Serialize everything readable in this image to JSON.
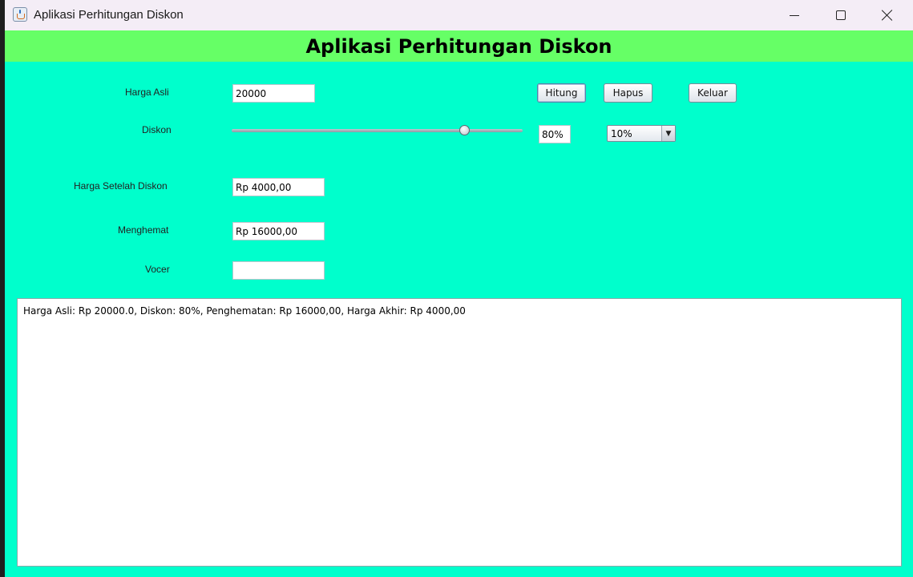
{
  "window": {
    "title": "Aplikasi Perhitungan Diskon",
    "controls": {
      "minimize": "minimize-icon",
      "maximize": "maximize-icon",
      "close": "close-icon"
    }
  },
  "banner": {
    "title": "Aplikasi Perhitungan Diskon",
    "color": "#66ff66"
  },
  "form": {
    "harga_asli": {
      "label": "Harga Asli",
      "value": "20000"
    },
    "diskon": {
      "label": "Diskon",
      "slider_value_percent": 80,
      "value_text": "80%"
    },
    "harga_setelah_diskon": {
      "label": "Harga Setelah Diskon",
      "value": "Rp 4000,00"
    },
    "menghemat": {
      "label": "Menghemat",
      "value": "Rp 16000,00"
    },
    "vocer": {
      "label": "Vocer",
      "value": ""
    }
  },
  "combo": {
    "selected": "10%"
  },
  "buttons": {
    "hitung": "Hitung",
    "hapus": "Hapus",
    "keluar": "Keluar"
  },
  "output": {
    "text": "Harga Asli: Rp 20000.0, Diskon: 80%, Penghematan: Rp 16000,00, Harga Akhir: Rp 4000,00"
  },
  "colors": {
    "background": "#00ffcc",
    "banner": "#66ff66",
    "titlebar": "#f4edf6"
  }
}
